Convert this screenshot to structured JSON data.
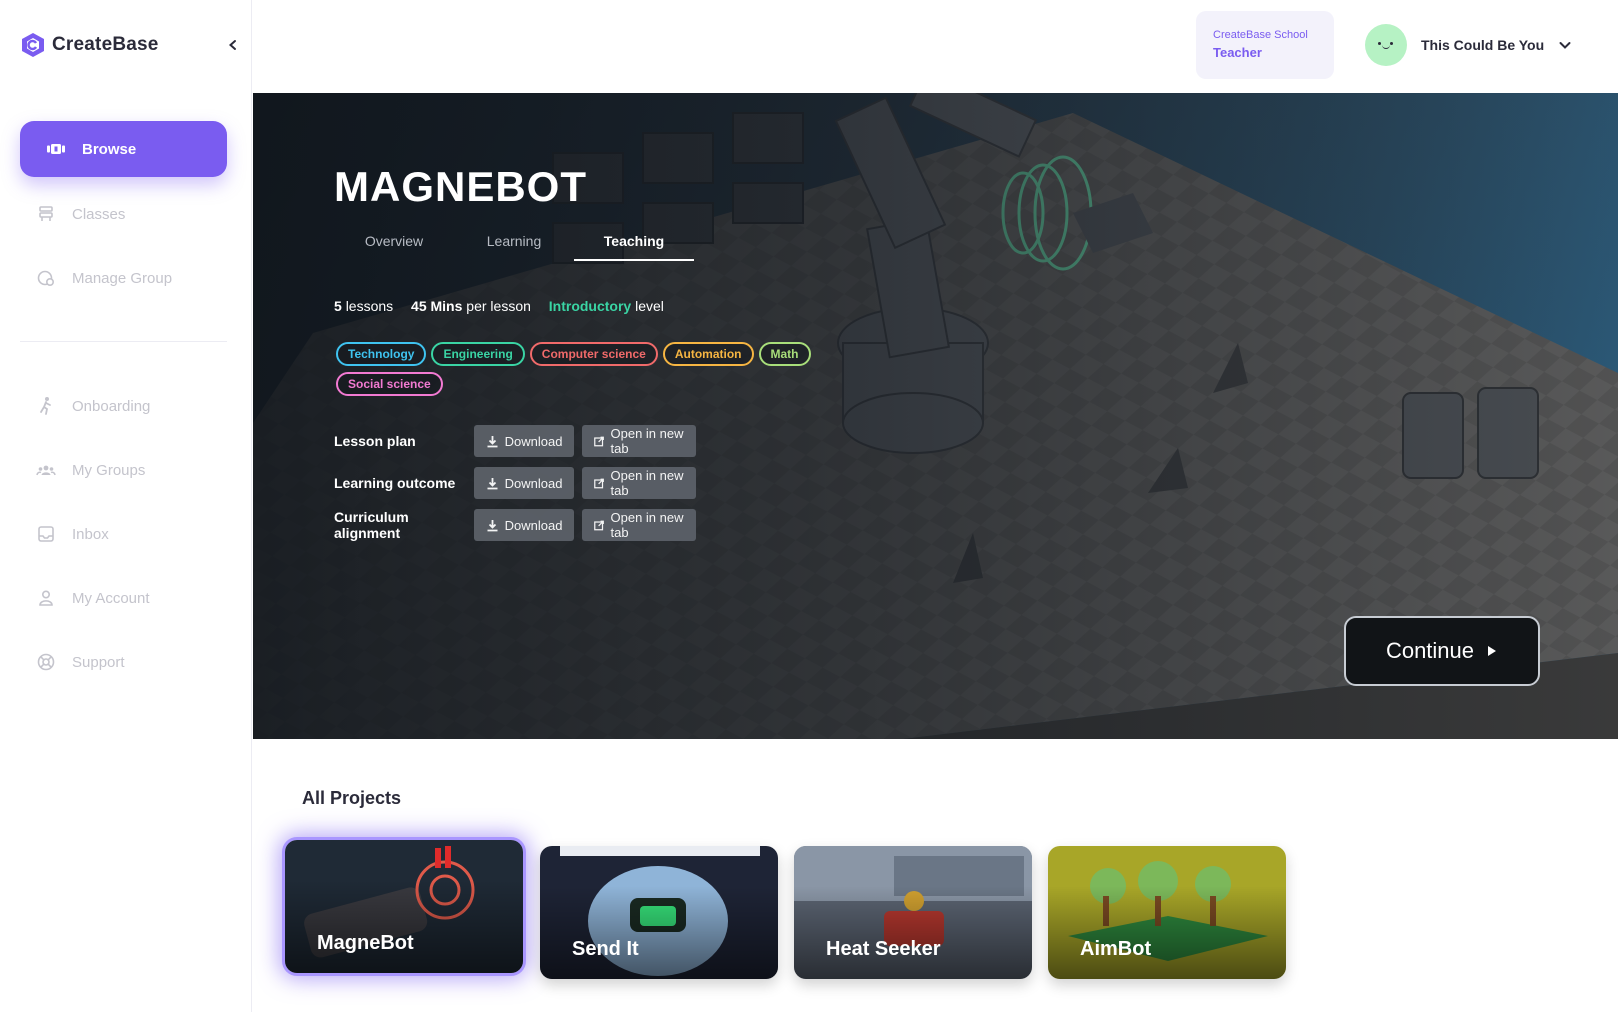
{
  "app": {
    "name": "CreateBase"
  },
  "sidebar": {
    "items": [
      {
        "label": "Browse",
        "icon": "browse-icon"
      },
      {
        "label": "Classes",
        "icon": "classes-icon"
      },
      {
        "label": "Manage Group",
        "icon": "manage-group-icon"
      },
      {
        "label": "Onboarding",
        "icon": "onboarding-icon"
      },
      {
        "label": "My Groups",
        "icon": "groups-icon"
      },
      {
        "label": "Inbox",
        "icon": "inbox-icon"
      },
      {
        "label": "My Account",
        "icon": "account-icon"
      },
      {
        "label": "Support",
        "icon": "support-icon"
      }
    ]
  },
  "header": {
    "school": "CreateBase School",
    "role": "Teacher",
    "user_name": "This Could Be You"
  },
  "hero": {
    "title": "MAGNEBOT",
    "tabs": [
      "Overview",
      "Learning",
      "Teaching"
    ],
    "active_tab": "Teaching",
    "lessons_count": "5",
    "lessons_label": "lessons",
    "duration": "45 Mins",
    "duration_label": "per lesson",
    "level": "Introductory",
    "level_label": "level",
    "tags": [
      {
        "label": "Technology",
        "color": "#3fc3f0"
      },
      {
        "label": "Engineering",
        "color": "#3ad4a4"
      },
      {
        "label": "Computer science",
        "color": "#f06a6a"
      },
      {
        "label": "Automation",
        "color": "#f6b542"
      },
      {
        "label": "Math",
        "color": "#a8de7a"
      },
      {
        "label": "Social science",
        "color": "#f27ad2"
      }
    ],
    "resources": [
      {
        "label": "Lesson plan",
        "download": "Download",
        "open": "Open in new tab"
      },
      {
        "label": "Learning outcome",
        "download": "Download",
        "open": "Open in new tab"
      },
      {
        "label": "Curriculum alignment",
        "download": "Download",
        "open": "Open in new tab"
      }
    ],
    "continue_label": "Continue"
  },
  "projects": {
    "title": "All Projects",
    "items": [
      {
        "title": "MagneBot",
        "color": "#1f2a36"
      },
      {
        "title": "Send It",
        "color": "#2a3a5c"
      },
      {
        "title": "Heat Seeker",
        "color": "#4a5566"
      },
      {
        "title": "AimBot",
        "color": "#9a9a22"
      }
    ]
  },
  "colors": {
    "accent": "#7a5cf0",
    "level": "#3ad4a4"
  }
}
